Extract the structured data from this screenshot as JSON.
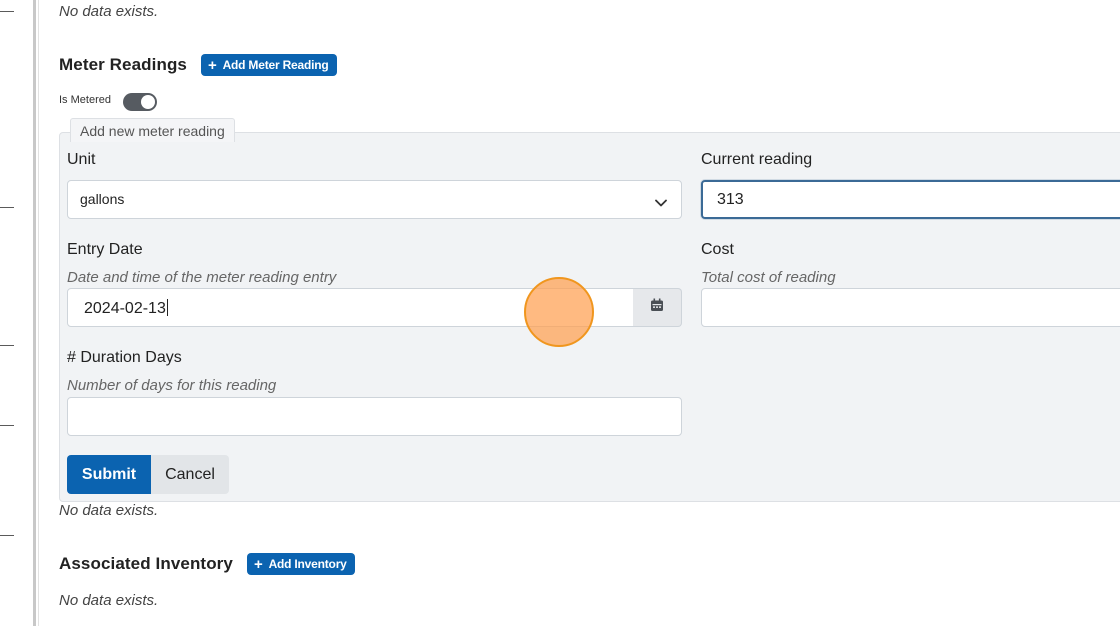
{
  "top_section": {
    "empty_text": "No data exists."
  },
  "meter_readings": {
    "title": "Meter Readings",
    "add_button": "Add Meter Reading",
    "is_metered_label": "Is Metered",
    "is_metered": true,
    "empty_text": "No data exists.",
    "form": {
      "legend": "Add new meter reading",
      "unit": {
        "label": "Unit",
        "value": "gallons"
      },
      "current_reading": {
        "label": "Current reading",
        "value": "313"
      },
      "entry_date": {
        "label": "Entry Date",
        "help": "Date and time of the meter reading entry",
        "value": "2024-02-13"
      },
      "cost": {
        "label": "Cost",
        "help": "Total cost of reading",
        "value": ""
      },
      "duration_days": {
        "label": "# Duration Days",
        "help": "Number of days for this reading",
        "value": ""
      },
      "submit_label": "Submit",
      "cancel_label": "Cancel"
    }
  },
  "associated_inventory": {
    "title": "Associated Inventory",
    "add_button": "Add Inventory",
    "empty_text": "No data exists."
  },
  "colors": {
    "primary": "#0b63b0",
    "focus_border": "#3b6a96",
    "click_indicator": "#f0961e"
  },
  "icons": [
    "plus-icon",
    "chevron-down-icon",
    "calendar-icon"
  ]
}
